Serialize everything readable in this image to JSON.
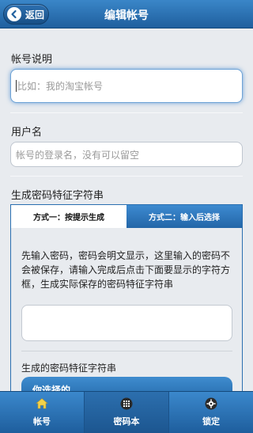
{
  "header": {
    "back_label": "返回",
    "title": "编辑帐号"
  },
  "account_desc": {
    "label": "帐号说明",
    "placeholder": "比如：我的淘宝帐号"
  },
  "username": {
    "label": "用户名",
    "placeholder": "帐号的登录名，没有可以留空"
  },
  "signature": {
    "label": "生成密码特征字符串",
    "tabs": [
      {
        "label": "方式一：按提示生成",
        "active": true
      },
      {
        "label": "方式二：输入后选择",
        "active": false
      }
    ],
    "description": "先输入密码，密码会明文显示，这里输入的密码不会被保存，请输入完成后点击下面要显示的字符方框，生成实际保存的密码特征字符串",
    "generated_label": "生成的密码特征字符串",
    "select_button": "你选择的"
  },
  "bottom_nav": {
    "items": [
      {
        "label": "帐号",
        "icon": "home-icon"
      },
      {
        "label": "密码本",
        "icon": "grid-icon"
      },
      {
        "label": "锁定",
        "icon": "gear-icon"
      }
    ]
  },
  "colors": {
    "primary": "#2a6fb0",
    "background": "#e8ebef"
  }
}
